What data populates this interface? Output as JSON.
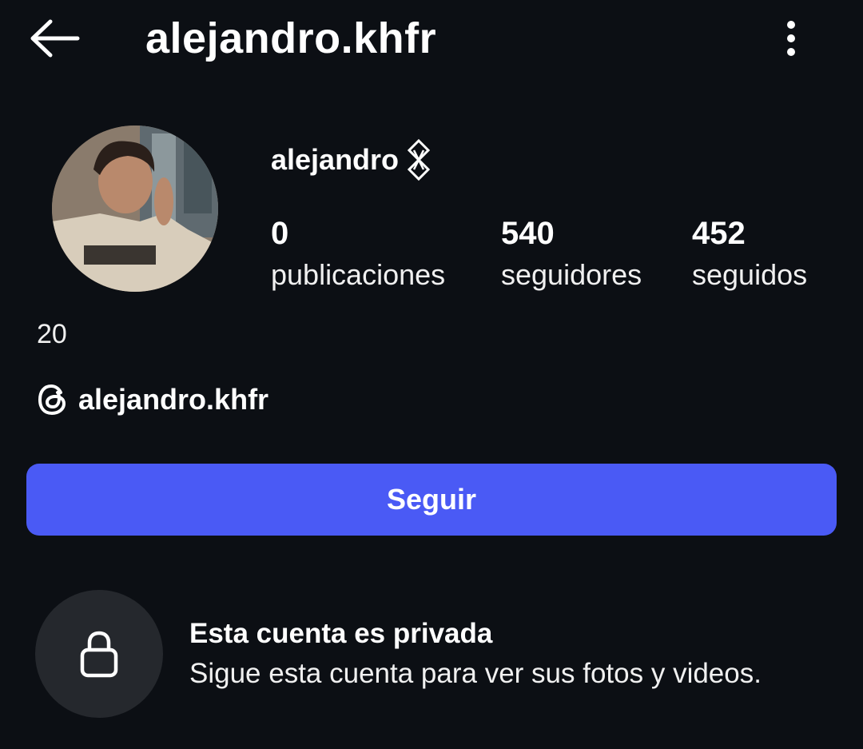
{
  "header": {
    "back_icon": "arrow-left-icon",
    "title": "alejandro.khfr",
    "menu_icon": "more-vertical-icon"
  },
  "profile": {
    "avatar_icon": "profile-photo",
    "display_name": "alejandro",
    "name_symbol_icon": "diamond-chain-icon",
    "stats": [
      {
        "count": "0",
        "label": "publicaciones"
      },
      {
        "count": "540",
        "label": "seguidores"
      },
      {
        "count": "452",
        "label": "seguidos"
      }
    ],
    "bio": "20",
    "threads_icon": "threads-icon",
    "threads_handle": "alejandro.khfr"
  },
  "follow_button": {
    "label": "Seguir",
    "color": "#4a5af5"
  },
  "private_notice": {
    "icon": "lock-icon",
    "title": "Esta cuenta es privada",
    "subtitle": "Sigue esta cuenta para ver sus fotos y videos."
  },
  "colors": {
    "background": "#0c0f14",
    "lock_circle": "#25282d"
  }
}
